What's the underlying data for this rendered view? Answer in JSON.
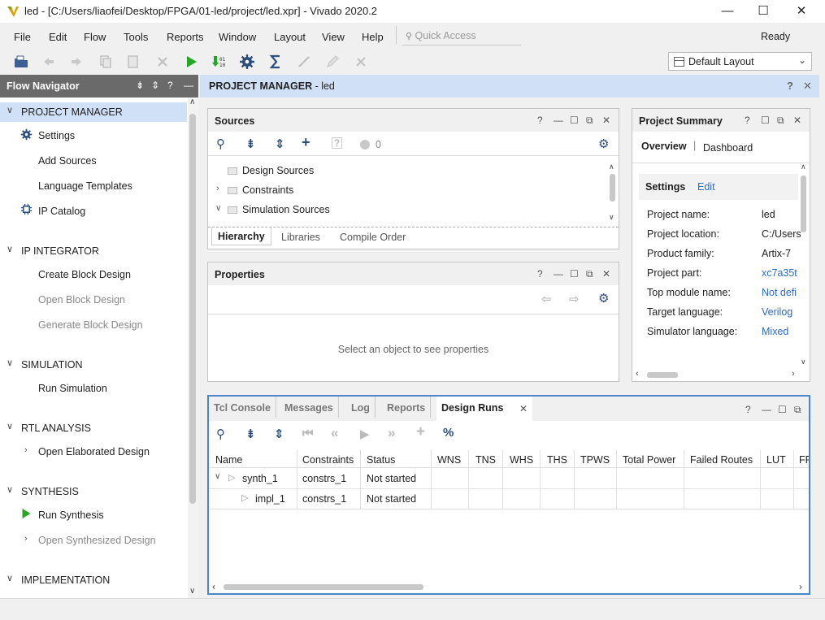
{
  "window": {
    "title": "led - [C:/Users/liaofei/Desktop/FPGA/01-led/project/led.xpr] - Vivado 2020.2",
    "minimize": "—",
    "maximize": "☐",
    "close": "✕"
  },
  "menu": [
    "File",
    "Edit",
    "Flow",
    "Tools",
    "Reports",
    "Window",
    "Layout",
    "View",
    "Help"
  ],
  "quick_access": {
    "placeholder": "Quick Access"
  },
  "status": "Ready",
  "layout_select": {
    "value": "Default Layout"
  },
  "flow_navigator": {
    "title": "Flow Navigator",
    "sections": [
      {
        "label": "PROJECT MANAGER",
        "items": [
          "Settings",
          "Add Sources",
          "Language Templates",
          "IP Catalog"
        ]
      },
      {
        "label": "IP INTEGRATOR",
        "items": [
          "Create Block Design",
          "Open Block Design",
          "Generate Block Design"
        ]
      },
      {
        "label": "SIMULATION",
        "items": [
          "Run Simulation"
        ]
      },
      {
        "label": "RTL ANALYSIS",
        "items": [
          "Open Elaborated Design"
        ]
      },
      {
        "label": "SYNTHESIS",
        "items": [
          "Run Synthesis",
          "Open Synthesized Design"
        ]
      },
      {
        "label": "IMPLEMENTATION",
        "items": []
      }
    ]
  },
  "project_manager": {
    "title": "PROJECT MANAGER",
    "project": " - led"
  },
  "sources": {
    "title": "Sources",
    "count": "0",
    "tree": [
      "Design Sources",
      "Constraints",
      "Simulation Sources"
    ],
    "tabs": [
      "Hierarchy",
      "Libraries",
      "Compile Order"
    ]
  },
  "properties": {
    "title": "Properties",
    "empty_message": "Select an object to see properties"
  },
  "project_summary": {
    "title": "Project Summary",
    "tabs": [
      "Overview",
      "Dashboard"
    ],
    "settings_label": "Settings",
    "edit_label": "Edit",
    "rows": [
      {
        "label": "Project name:",
        "value": "led"
      },
      {
        "label": "Project location:",
        "value": "C:/Users"
      },
      {
        "label": "Product family:",
        "value": "Artix-7"
      },
      {
        "label": "Project part:",
        "value": "xc7a35t"
      },
      {
        "label": "Top module name:",
        "value": "Not defi"
      },
      {
        "label": "Target language:",
        "value": "Verilog"
      },
      {
        "label": "Simulator language:",
        "value": "Mixed"
      }
    ]
  },
  "bottom": {
    "tabs": [
      "Tcl Console",
      "Messages",
      "Log",
      "Reports",
      "Design Runs"
    ],
    "columns": [
      "Name",
      "Constraints",
      "Status",
      "WNS",
      "TNS",
      "WHS",
      "THS",
      "TPWS",
      "Total Power",
      "Failed Routes",
      "LUT",
      "FF"
    ],
    "runs": [
      {
        "name": "synth_1",
        "constraints": "constrs_1",
        "status": "Not started"
      },
      {
        "name": "impl_1",
        "constraints": "constrs_1",
        "status": "Not started"
      }
    ]
  },
  "colors": {
    "accent": "#2b6cc4",
    "selection": "#cfe0f7",
    "run_green": "#22a822"
  }
}
